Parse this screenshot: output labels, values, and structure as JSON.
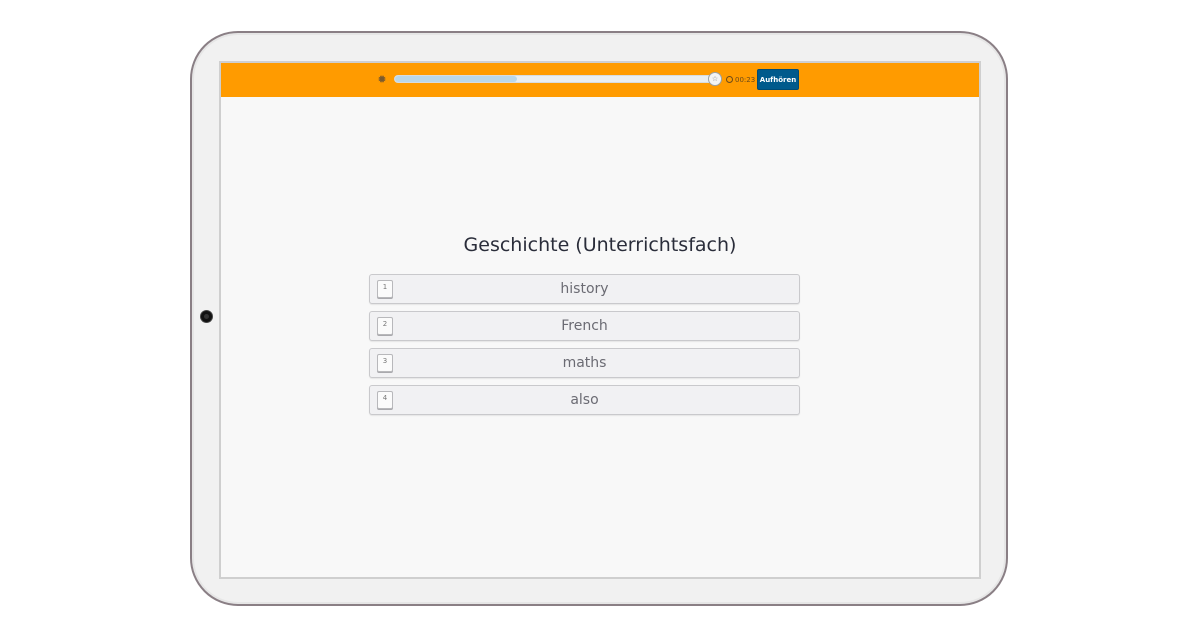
{
  "toolbar": {
    "settings_icon": "gear-icon",
    "progress": 0.38,
    "progress_end_icon": "star-icon",
    "timer_icon": "clock-icon",
    "timer": "00:23",
    "stop_label": "Aufhören",
    "accent_color": "#ff9b00",
    "button_color": "#005a8c"
  },
  "question": {
    "text": "Geschichte (Unterrichtsfach)"
  },
  "answers": [
    {
      "key": "1",
      "label": "history"
    },
    {
      "key": "2",
      "label": "French"
    },
    {
      "key": "3",
      "label": "maths"
    },
    {
      "key": "4",
      "label": "also"
    }
  ]
}
